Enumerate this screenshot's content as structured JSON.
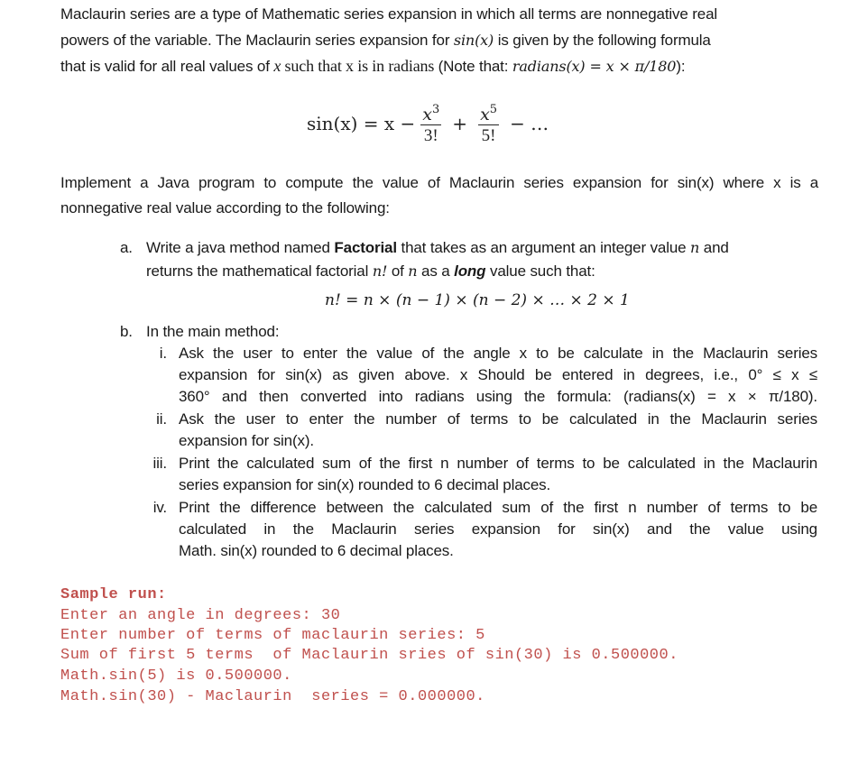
{
  "intro": {
    "line1": "Maclaurin series are a type of Mathematic series expansion in which all terms are nonnegative real",
    "line2_prefix": "powers of the variable. The Maclaurin series expansion for ",
    "line2_math": "sin(x)",
    "line2_suffix": " is given by the following formula",
    "line3_prefix": "that is valid for all real values of ",
    "line3_x": "x",
    "line3_mid": " such that x is in radians ",
    "line3_note_prefix": "(Note that: ",
    "line3_note_math": "radians(x) = x × π/180",
    "line3_note_suffix": "):"
  },
  "formula": {
    "lhs": "sin(x) = x −",
    "term1_num": "x",
    "term1_exp": "3",
    "term1_den": "3!",
    "op_plus": "+",
    "term2_num": "x",
    "term2_exp": "5",
    "term2_den": "5!",
    "tail": "− …"
  },
  "task": {
    "line1": "Implement a Java program to compute the value of Maclaurin series expansion for sin(x) where x is a",
    "line2": "nonnegative real value according to the following:"
  },
  "item_a": {
    "marker": "a.",
    "line1_prefix": "Write a java method named ",
    "line1_bold": "Factorial",
    "line1_mid": " that takes as an argument an integer value ",
    "line1_n": "n",
    "line1_suffix": " and",
    "line2_prefix": "returns the mathematical factorial ",
    "line2_nfact": "n!",
    "line2_of": " of ",
    "line2_n": "n",
    "line2_as": " as a ",
    "line2_bolditalic": "long",
    "line2_suffix": " value such that:",
    "equation": "n! = n × (n − 1) × (n − 2) × … × 2 × 1"
  },
  "item_b": {
    "marker": "b.",
    "heading": "In the main method:",
    "sub": [
      {
        "marker": "i.",
        "lines": [
          "Ask the user to enter the value of the angle x to be calculate in the Maclaurin series",
          "expansion for sin(x) as given above. x Should be entered in degrees, i.e., 0° ≤ x ≤",
          "360° and then converted into radians using the formula: (radians(x) = x × π/180)."
        ]
      },
      {
        "marker": "ii.",
        "lines": [
          "Ask the user to enter the number of terms to be calculated in the Maclaurin series",
          "expansion for sin(x)."
        ]
      },
      {
        "marker": "iii.",
        "lines": [
          "Print the calculated sum of the first n number of terms to be calculated in the Maclaurin",
          "series expansion for sin(x) rounded to 6 decimal places."
        ]
      },
      {
        "marker": "iv.",
        "lines": [
          "Print the difference between the calculated sum of the first n number of terms to be",
          "calculated in the Maclaurin series expansion for sin(x) and the value using",
          "Math. sin(x) rounded to 6 decimal places."
        ]
      }
    ]
  },
  "sample_run": {
    "heading": "Sample run:",
    "lines": [
      "Enter an angle in degrees: 30",
      "Enter number of terms of maclaurin series: 5",
      "Sum of first 5 terms  of Maclaurin sries of sin(30) is 0.500000.",
      "Math.sin(5) is 0.500000.",
      "Math.sin(30) - Maclaurin  series = 0.000000."
    ]
  },
  "colors": {
    "text": "#1a1a1a",
    "code": "#c0504d"
  }
}
